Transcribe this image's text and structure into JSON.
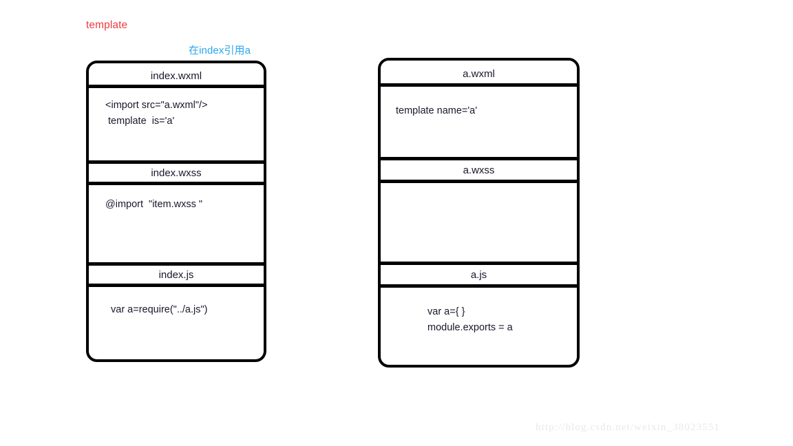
{
  "annotations": {
    "template_label": "template",
    "template_color": "#ee3b41",
    "reference_label": "在index引用a",
    "reference_color": "#28a6ef"
  },
  "diagram": {
    "title": "template",
    "panels": [
      {
        "id": "index",
        "name": "index",
        "sections": [
          {
            "header": "index.wxml",
            "lines": [
              "<import src=\"a.wxml\"/>",
              " template  is='a'"
            ]
          },
          {
            "header": "index.wxss",
            "lines": [
              "@import  \"item.wxss \""
            ]
          },
          {
            "header": "index.js",
            "lines": [
              "var a=require(\"../a.js\")"
            ]
          }
        ]
      },
      {
        "id": "a",
        "name": "a",
        "sections": [
          {
            "header": "a.wxml",
            "lines": [
              "template name='a'"
            ]
          },
          {
            "header": "a.wxss",
            "lines": [
              ""
            ]
          },
          {
            "header": "a.js",
            "lines": [
              "var a={ }",
              "module.exports = a"
            ]
          }
        ]
      }
    ]
  },
  "watermark": {
    "text": "http://blog.csdn.net/weixin_38023551"
  }
}
